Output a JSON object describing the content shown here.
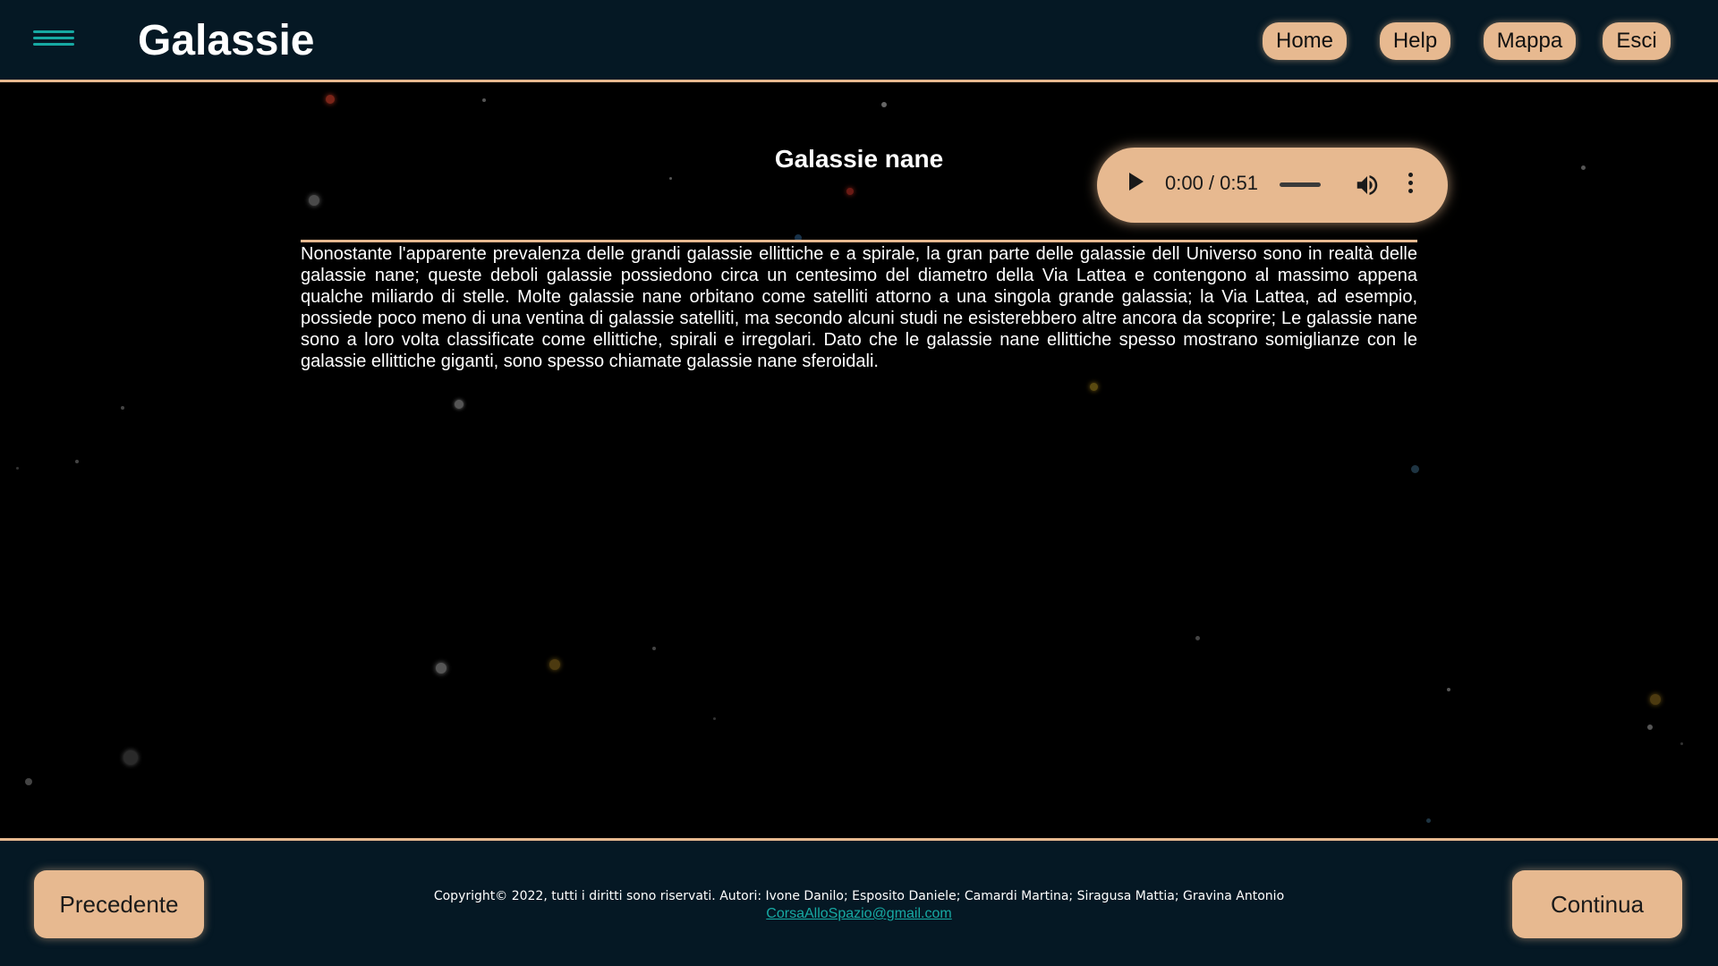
{
  "header": {
    "title": "Galassie",
    "nav": [
      {
        "label": "Home"
      },
      {
        "label": "Help"
      },
      {
        "label": "Mappa"
      },
      {
        "label": "Esci"
      }
    ]
  },
  "main": {
    "section_title": "Galassie nane",
    "audio": {
      "time": "0:00 / 0:51",
      "progress": 0
    },
    "body": "Nonostante l'apparente prevalenza delle grandi galassie ellittiche e a spirale, la gran parte delle galassie dell Universo sono in realtà delle galassie nane; queste deboli galassie possiedono circa un centesimo del diametro della Via Lattea e contengono al massimo appena qualche miliardo di stelle. Molte galassie nane orbitano come satelliti attorno a una singola grande galassia; la Via Lattea, ad esempio, possiede poco meno di una ventina di galassie satelliti, ma secondo alcuni studi ne esisterebbero altre ancora da scoprire; Le galassie nane sono a loro volta classificate come ellittiche, spirali e irregolari. Dato che le galassie nane ellittiche spesso mostrano somiglianze con le galassie ellittiche giganti, sono spesso chiamate galassie nane sferoidali."
  },
  "footer": {
    "prev_label": "Precedente",
    "next_label": "Continua",
    "copyright": "Copyright© 2022, tutti i diritti sono riservati. Autori: Ivone Danilo; Esposito Daniele; Camardi Martina; Siragusa Mattia; Gravina Antonio",
    "email": "CorsaAlloSpazio@gmail.com"
  },
  "colors": {
    "accent": "#e7b990",
    "header_bg": "#051824",
    "menu_icon": "#17a9a3",
    "link": "#17a9a3"
  },
  "icons": {
    "menu": "hamburger-icon",
    "play": "play-icon",
    "volume": "volume-icon",
    "more": "more-vertical-icon"
  }
}
